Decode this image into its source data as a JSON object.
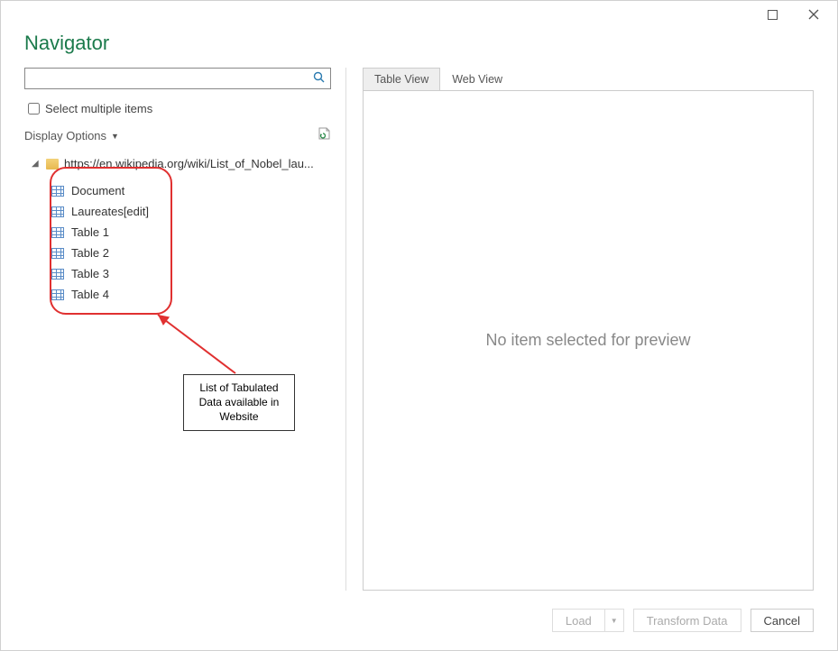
{
  "window": {
    "title": "Navigator"
  },
  "left": {
    "search_placeholder": "",
    "select_multiple": "Select multiple items",
    "display_options": "Display Options",
    "root_url": "https://en.wikipedia.org/wiki/List_of_Nobel_lau...",
    "tables": [
      {
        "label": "Document"
      },
      {
        "label": "Laureates[edit]"
      },
      {
        "label": "Table 1"
      },
      {
        "label": "Table 2"
      },
      {
        "label": "Table 3"
      },
      {
        "label": "Table 4"
      }
    ]
  },
  "right": {
    "tab_table": "Table View",
    "tab_web": "Web View",
    "preview_empty": "No item selected for preview"
  },
  "footer": {
    "load": "Load",
    "transform": "Transform Data",
    "cancel": "Cancel"
  },
  "annotation": {
    "line1": "List of Tabulated",
    "line2": "Data available in",
    "line3": "Website"
  }
}
